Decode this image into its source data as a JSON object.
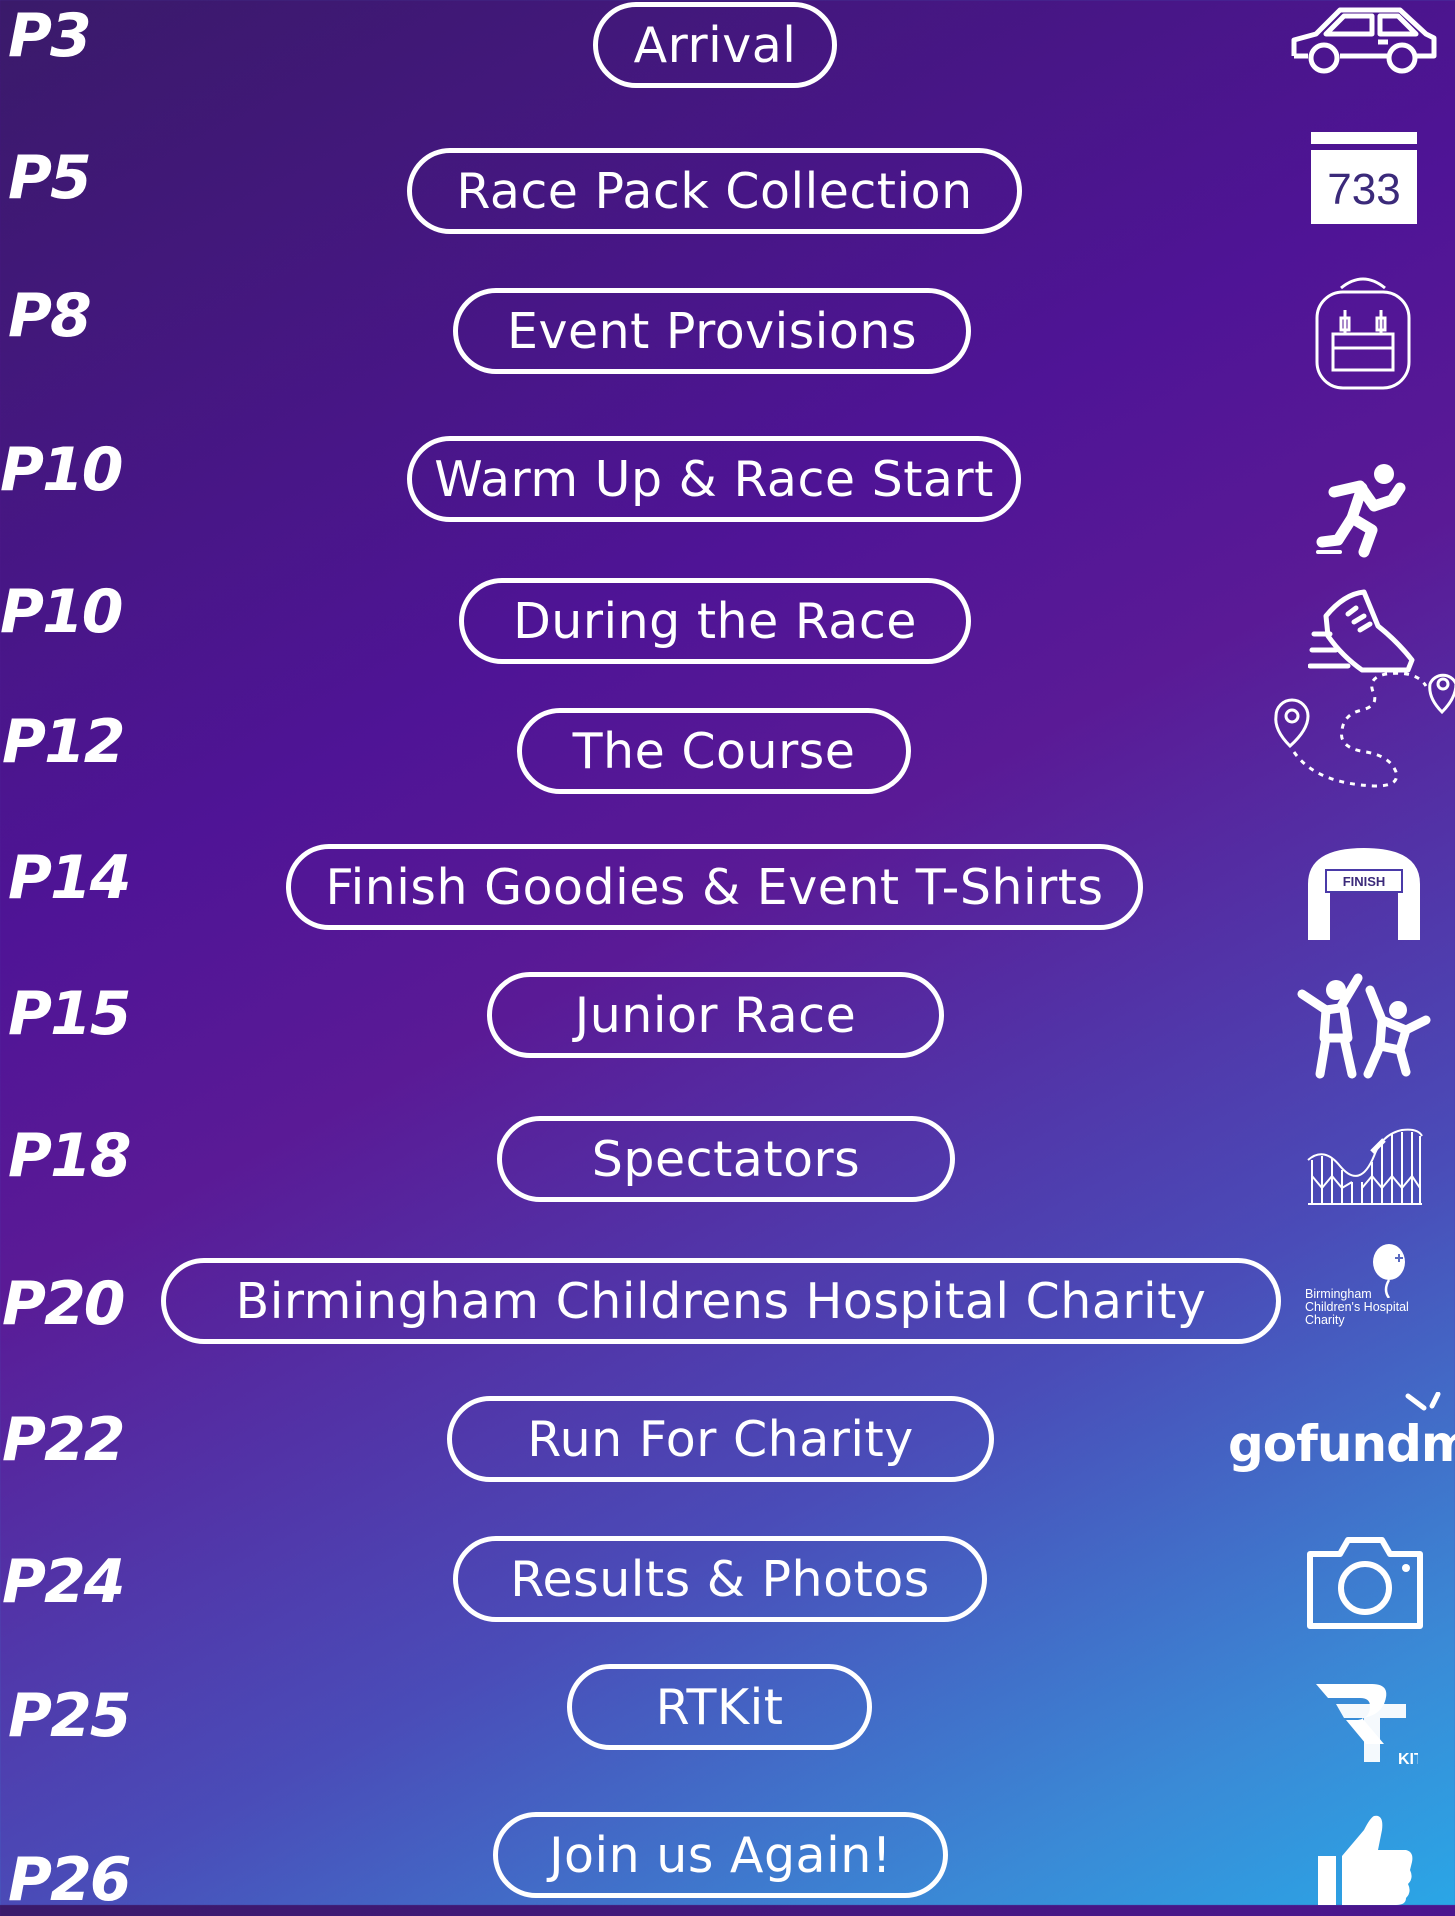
{
  "entries": [
    {
      "page": "P3",
      "label": "Arrival",
      "icon": "car-icon"
    },
    {
      "page": "P5",
      "label": "Race Pack Collection",
      "icon": "race-number-bib-icon",
      "icon_text": "733"
    },
    {
      "page": "P8",
      "label": "Event Provisions",
      "icon": "backpack-icon"
    },
    {
      "page": "P10",
      "label": "Warm Up & Race Start",
      "icon": "runner-icon"
    },
    {
      "page": "P10",
      "label": "During the Race",
      "icon": "running-shoe-icon"
    },
    {
      "page": "P12",
      "label": "The Course",
      "icon": "route-map-pin-icon"
    },
    {
      "page": "P14",
      "label": "Finish Goodies & Event T-Shirts",
      "icon": "finish-arch-icon",
      "icon_text": "FINISH"
    },
    {
      "page": "P15",
      "label": "Junior Race",
      "icon": "children-jumping-icon"
    },
    {
      "page": "P18",
      "label": "Spectators",
      "icon": "rollercoaster-icon"
    },
    {
      "page": "P20",
      "label": "Birmingham Childrens Hospital Charity",
      "icon": "bch-charity-logo",
      "icon_text": "Birmingham Children's Hospital Charity"
    },
    {
      "page": "P22",
      "label": "Run For Charity",
      "icon": "gofundme-logo",
      "icon_text": "gofundm"
    },
    {
      "page": "P24",
      "label": "Results & Photos",
      "icon": "camera-icon"
    },
    {
      "page": "P25",
      "label": "RTKit",
      "icon": "rtkit-logo",
      "icon_text": "KIT"
    },
    {
      "page": "P26",
      "label": "Join us Again!",
      "icon": "thumbs-up-icon"
    }
  ]
}
